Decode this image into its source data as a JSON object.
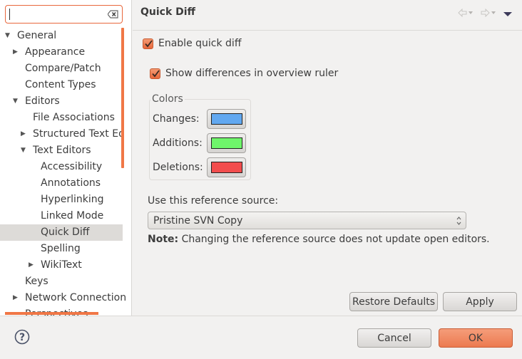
{
  "search": {
    "value": "",
    "placeholder": ""
  },
  "tree": [
    {
      "label": "General",
      "level": 0,
      "toggle": "expanded"
    },
    {
      "label": "Appearance",
      "level": 1,
      "toggle": "collapsed"
    },
    {
      "label": "Compare/Patch",
      "level": 1,
      "toggle": "none"
    },
    {
      "label": "Content Types",
      "level": 1,
      "toggle": "none"
    },
    {
      "label": "Editors",
      "level": 1,
      "toggle": "expanded"
    },
    {
      "label": "File Associations",
      "level": 2,
      "toggle": "none"
    },
    {
      "label": "Structured Text Ed",
      "level": 2,
      "toggle": "collapsed"
    },
    {
      "label": "Text Editors",
      "level": 2,
      "toggle": "expanded"
    },
    {
      "label": "Accessibility",
      "level": 3,
      "toggle": "none"
    },
    {
      "label": "Annotations",
      "level": 3,
      "toggle": "none"
    },
    {
      "label": "Hyperlinking",
      "level": 3,
      "toggle": "none"
    },
    {
      "label": "Linked Mode",
      "level": 3,
      "toggle": "none"
    },
    {
      "label": "Quick Diff",
      "level": 3,
      "toggle": "none",
      "selected": true
    },
    {
      "label": "Spelling",
      "level": 3,
      "toggle": "none"
    },
    {
      "label": "WikiText",
      "level": 3,
      "toggle": "collapsed"
    },
    {
      "label": "Keys",
      "level": 1,
      "toggle": "none"
    },
    {
      "label": "Network Connection",
      "level": 1,
      "toggle": "collapsed"
    },
    {
      "label": "Perspectives",
      "level": 1,
      "toggle": "none"
    }
  ],
  "page": {
    "title": "Quick Diff",
    "enable_quick_diff": {
      "label": "Enable quick diff",
      "checked": true
    },
    "show_differences": {
      "label": "Show differences in overview ruler",
      "checked": true
    },
    "colors": {
      "legend": "Colors",
      "items": [
        {
          "label": "Changes:",
          "color": "#62a8f0"
        },
        {
          "label": "Additions:",
          "color": "#6ff56b"
        },
        {
          "label": "Deletions:",
          "color": "#f24d4d"
        }
      ]
    },
    "reference": {
      "label": "Use this reference source:",
      "selected": "Pristine SVN Copy"
    },
    "note": {
      "bold": "Note:",
      "text": "Changing the reference source does not update open editors."
    },
    "restore_defaults_label": "Restore Defaults",
    "apply_label": "Apply"
  },
  "footer": {
    "cancel_label": "Cancel",
    "ok_label": "OK"
  },
  "colors": {
    "accent": "#e8673c",
    "primary_button": "#f08a62"
  }
}
